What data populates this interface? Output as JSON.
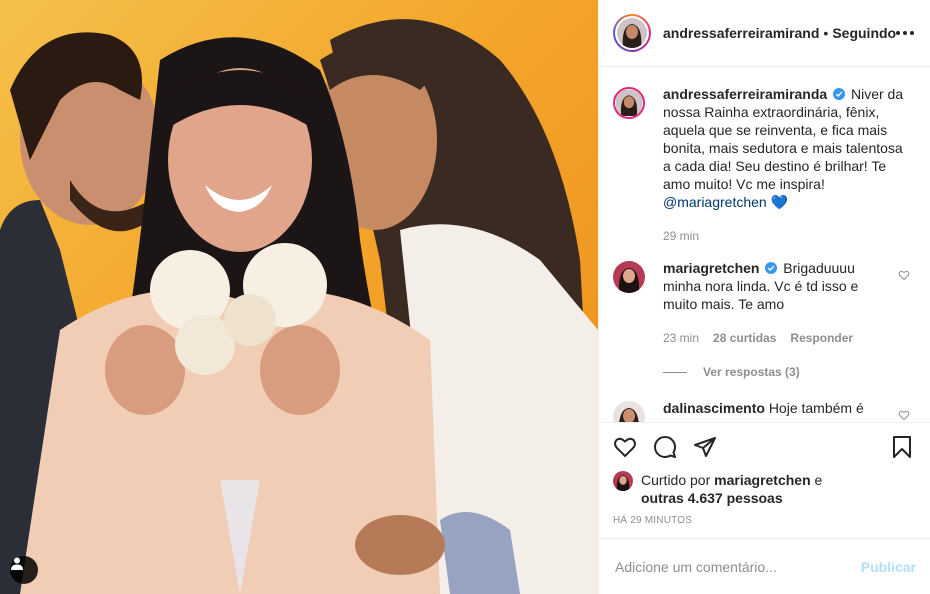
{
  "post": {
    "author": "andressaferreiramirand",
    "dot": "•",
    "following": "Seguindo"
  },
  "caption": {
    "user": "andressaferreiramiranda",
    "text": "Niver da nossa Rainha extraordinária, fênix, aquela que se reinventa, e fica mais bonita, mais sedutora e mais talentosa a cada dia! Seu destino é brilhar! Te amo muito! Vc me inspira!",
    "mention": "@mariagretchen",
    "emoji": "💙",
    "time": "29 min"
  },
  "comments": [
    {
      "user": "mariagretchen",
      "text": "Brigaduuuu minha nora linda. Vc é td isso e muito mais. Te amo",
      "time": "23 min",
      "likes": "28 curtidas",
      "reply": "Responder",
      "view_replies": "Ver respostas (3)"
    },
    {
      "user": "dalinascimento",
      "text": "Hoje também é"
    }
  ],
  "likes": {
    "prefix": "Curtido por",
    "user": "mariagretchen",
    "and": "e",
    "others": "outras 4.637 pessoas"
  },
  "timestamp": "HÁ 29 MINUTOS",
  "add_comment": {
    "placeholder": "Adicione um comentário...",
    "publish": "Publicar"
  },
  "colors": {
    "verified": "#3897f0",
    "publish_disabled": "#b2dffc",
    "photo_bg": "#f3a52a"
  }
}
